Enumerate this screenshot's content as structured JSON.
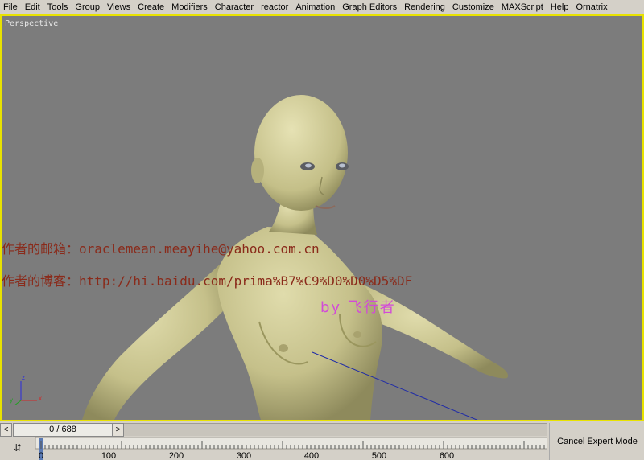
{
  "menu": [
    "File",
    "Edit",
    "Tools",
    "Group",
    "Views",
    "Create",
    "Modifiers",
    "Character",
    "reactor",
    "Animation",
    "Graph Editors",
    "Rendering",
    "Customize",
    "MAXScript",
    "Help",
    "Ornatrix"
  ],
  "viewport": {
    "label": "Perspective",
    "watermark_email": "作者的邮箱：oraclemean.meayihe@yahoo.com.cn",
    "watermark_blog": "作者的博客：http://hi.baidu.com/prima%B7%C9%D0%D0%D5%DF",
    "watermark_by": "by 飞行者",
    "axis": {
      "z": "z",
      "y": "y",
      "x": "x"
    }
  },
  "timeline": {
    "frame_display": "0 / 688",
    "prev": "<",
    "next": ">",
    "ticks": [
      "0",
      "100",
      "200",
      "300",
      "400",
      "500",
      "600"
    ]
  },
  "status": {
    "cancel_expert_mode": "Cancel Expert Mode"
  },
  "colors": {
    "viewport_bg": "#7c7c7c",
    "viewport_border": "#e8e200",
    "model_fill": "#c9c48f"
  }
}
